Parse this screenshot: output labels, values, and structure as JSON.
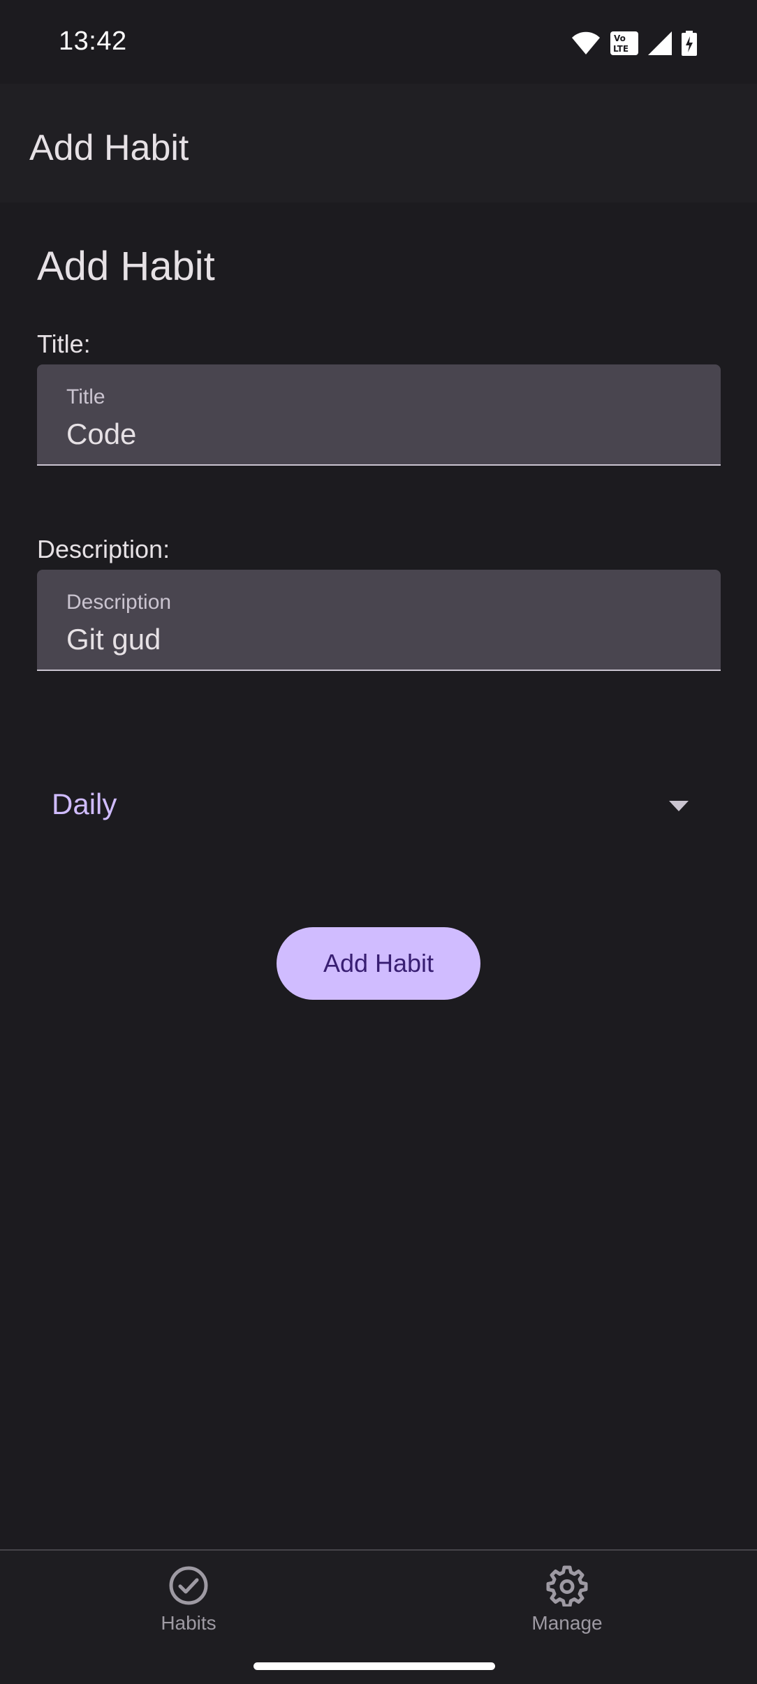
{
  "status_bar": {
    "time": "13:42",
    "icons": [
      "wifi-icon",
      "volte-icon",
      "signal-icon",
      "battery-charging-icon"
    ],
    "volte_line1": "Vo",
    "volte_line2": "LTE"
  },
  "app_bar": {
    "title": "Add Habit"
  },
  "form": {
    "heading": "Add Habit",
    "title_caption": "Title:",
    "title_field": {
      "label": "Title",
      "value": "Code"
    },
    "description_caption": "Description:",
    "description_field": {
      "label": "Description",
      "value": "Git gud"
    },
    "frequency": {
      "selected": "Daily",
      "icon": "dropdown-arrow-icon"
    },
    "submit_label": "Add Habit"
  },
  "bottom_nav": {
    "items": [
      {
        "label": "Habits",
        "icon": "check-circle-icon"
      },
      {
        "label": "Manage",
        "icon": "gear-icon"
      }
    ]
  },
  "colors": {
    "background": "#1c1b1f",
    "accent": "#d0bcff",
    "on_accent": "#381e72",
    "field_fill": "#49454f"
  }
}
